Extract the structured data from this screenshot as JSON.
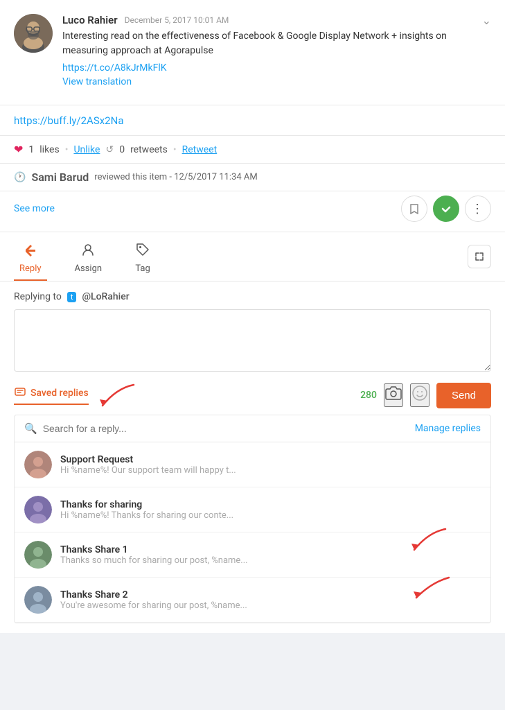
{
  "post": {
    "author": "Luco Rahier",
    "date": "December 5, 2017 10:01 AM",
    "content": "Interesting read on the effectiveness of Facebook & Google Display Network + insights on measuring approach at Agorapulse",
    "link": "https://t.co/A8kJrMkFlK",
    "view_translation": "View translation",
    "buff_link": "https://buff.ly/2ASx2Na",
    "likes_count": "1",
    "likes_label": "likes",
    "unlike_label": "Unlike",
    "retweets_count": "0",
    "retweets_label": "retweets",
    "retweet_label": "Retweet",
    "reviewer": "Sami Barud",
    "review_text": "reviewed this item - 12/5/2017 11:34 AM",
    "see_more_label": "See more"
  },
  "tabs": {
    "reply_label": "Reply",
    "assign_label": "Assign",
    "tag_label": "Tag"
  },
  "reply": {
    "replying_to_label": "Replying to",
    "mention": "@LoRahier",
    "textarea_placeholder": "",
    "char_count": "280",
    "send_label": "Send",
    "saved_replies_label": "Saved replies",
    "manage_replies_label": "Manage replies",
    "search_placeholder": "Search for a reply..."
  },
  "saved_replies": [
    {
      "title": "Support Request",
      "preview": "Hi %name%! Our support team will happy t...",
      "avatar_color": "#b0857a"
    },
    {
      "title": "Thanks for sharing",
      "preview": "Hi %name%! Thanks for sharing our conte...",
      "avatar_color": "#7b6ea8"
    },
    {
      "title": "Thanks Share 1",
      "preview": "Thanks so much for sharing our post, %name...",
      "avatar_color": "#6a8c6a"
    },
    {
      "title": "Thanks Share 2",
      "preview": "You're awesome for sharing our post, %name...",
      "avatar_color": "#7a8ca0"
    }
  ]
}
